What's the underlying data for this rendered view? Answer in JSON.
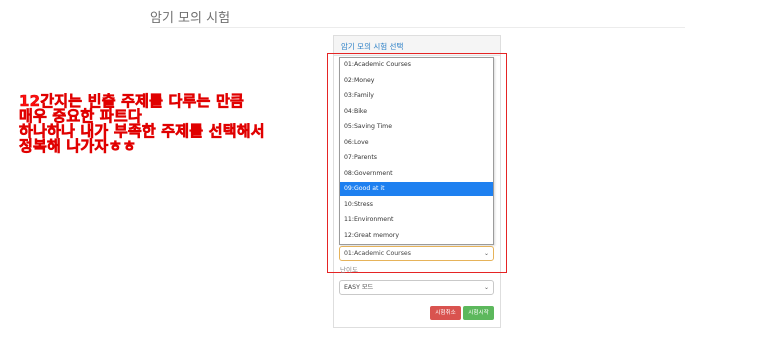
{
  "page": {
    "title": "암기 모의 시험"
  },
  "annotation": {
    "lines": [
      "12간지는 빈출 주제를 다루는 만큼",
      "매우 중요한 파트다",
      "하나하나 내가 부족한 주제를 선택해서",
      "정복해 나가자ㅎㅎ"
    ],
    "color": "#ff1010"
  },
  "panel": {
    "title": "암기 모의 시험 선택"
  },
  "topic_dropdown": {
    "options": [
      "01:Academic Courses",
      "02:Money",
      "03:Family",
      "04:Bike",
      "05:Saving Time",
      "06:Love",
      "07:Parents",
      "08:Government",
      "09:Good at it",
      "10:Stress",
      "11:Environment",
      "12:Great memory"
    ],
    "highlighted": "09:Good at it",
    "highlight_color": "#1e80f0"
  },
  "topic_select": {
    "value": "01:Academic Courses"
  },
  "difficulty": {
    "label": "난이도",
    "value": "EASY 모드"
  },
  "buttons": {
    "cancel": {
      "label": "시험취소",
      "color": "#d9534f"
    },
    "start": {
      "label": "시험시작",
      "color": "#5cb85c"
    }
  }
}
